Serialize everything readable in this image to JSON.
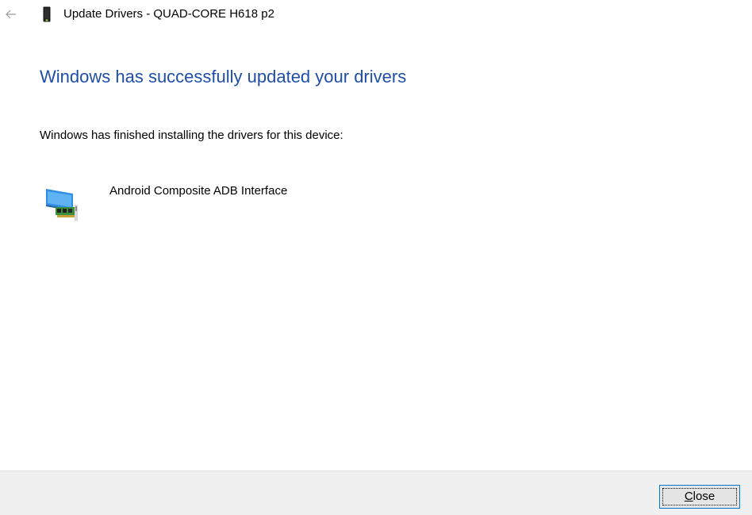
{
  "window": {
    "title": "Update Drivers - QUAD-CORE H618 p2",
    "back_icon": "back-arrow-icon",
    "title_icon": "device-icon"
  },
  "content": {
    "heading": "Windows has successfully updated your drivers",
    "subtext": "Windows has finished installing the drivers for this device:",
    "device_name": "Android Composite ADB Interface",
    "device_icon": "network-adapter-icon"
  },
  "footer": {
    "close_label": "Close",
    "close_mnemonic": "C",
    "close_rest": "lose"
  },
  "colors": {
    "heading": "#1f4ea6",
    "footer_bg": "#f0f0f0",
    "button_border_focus": "#0078d7"
  }
}
